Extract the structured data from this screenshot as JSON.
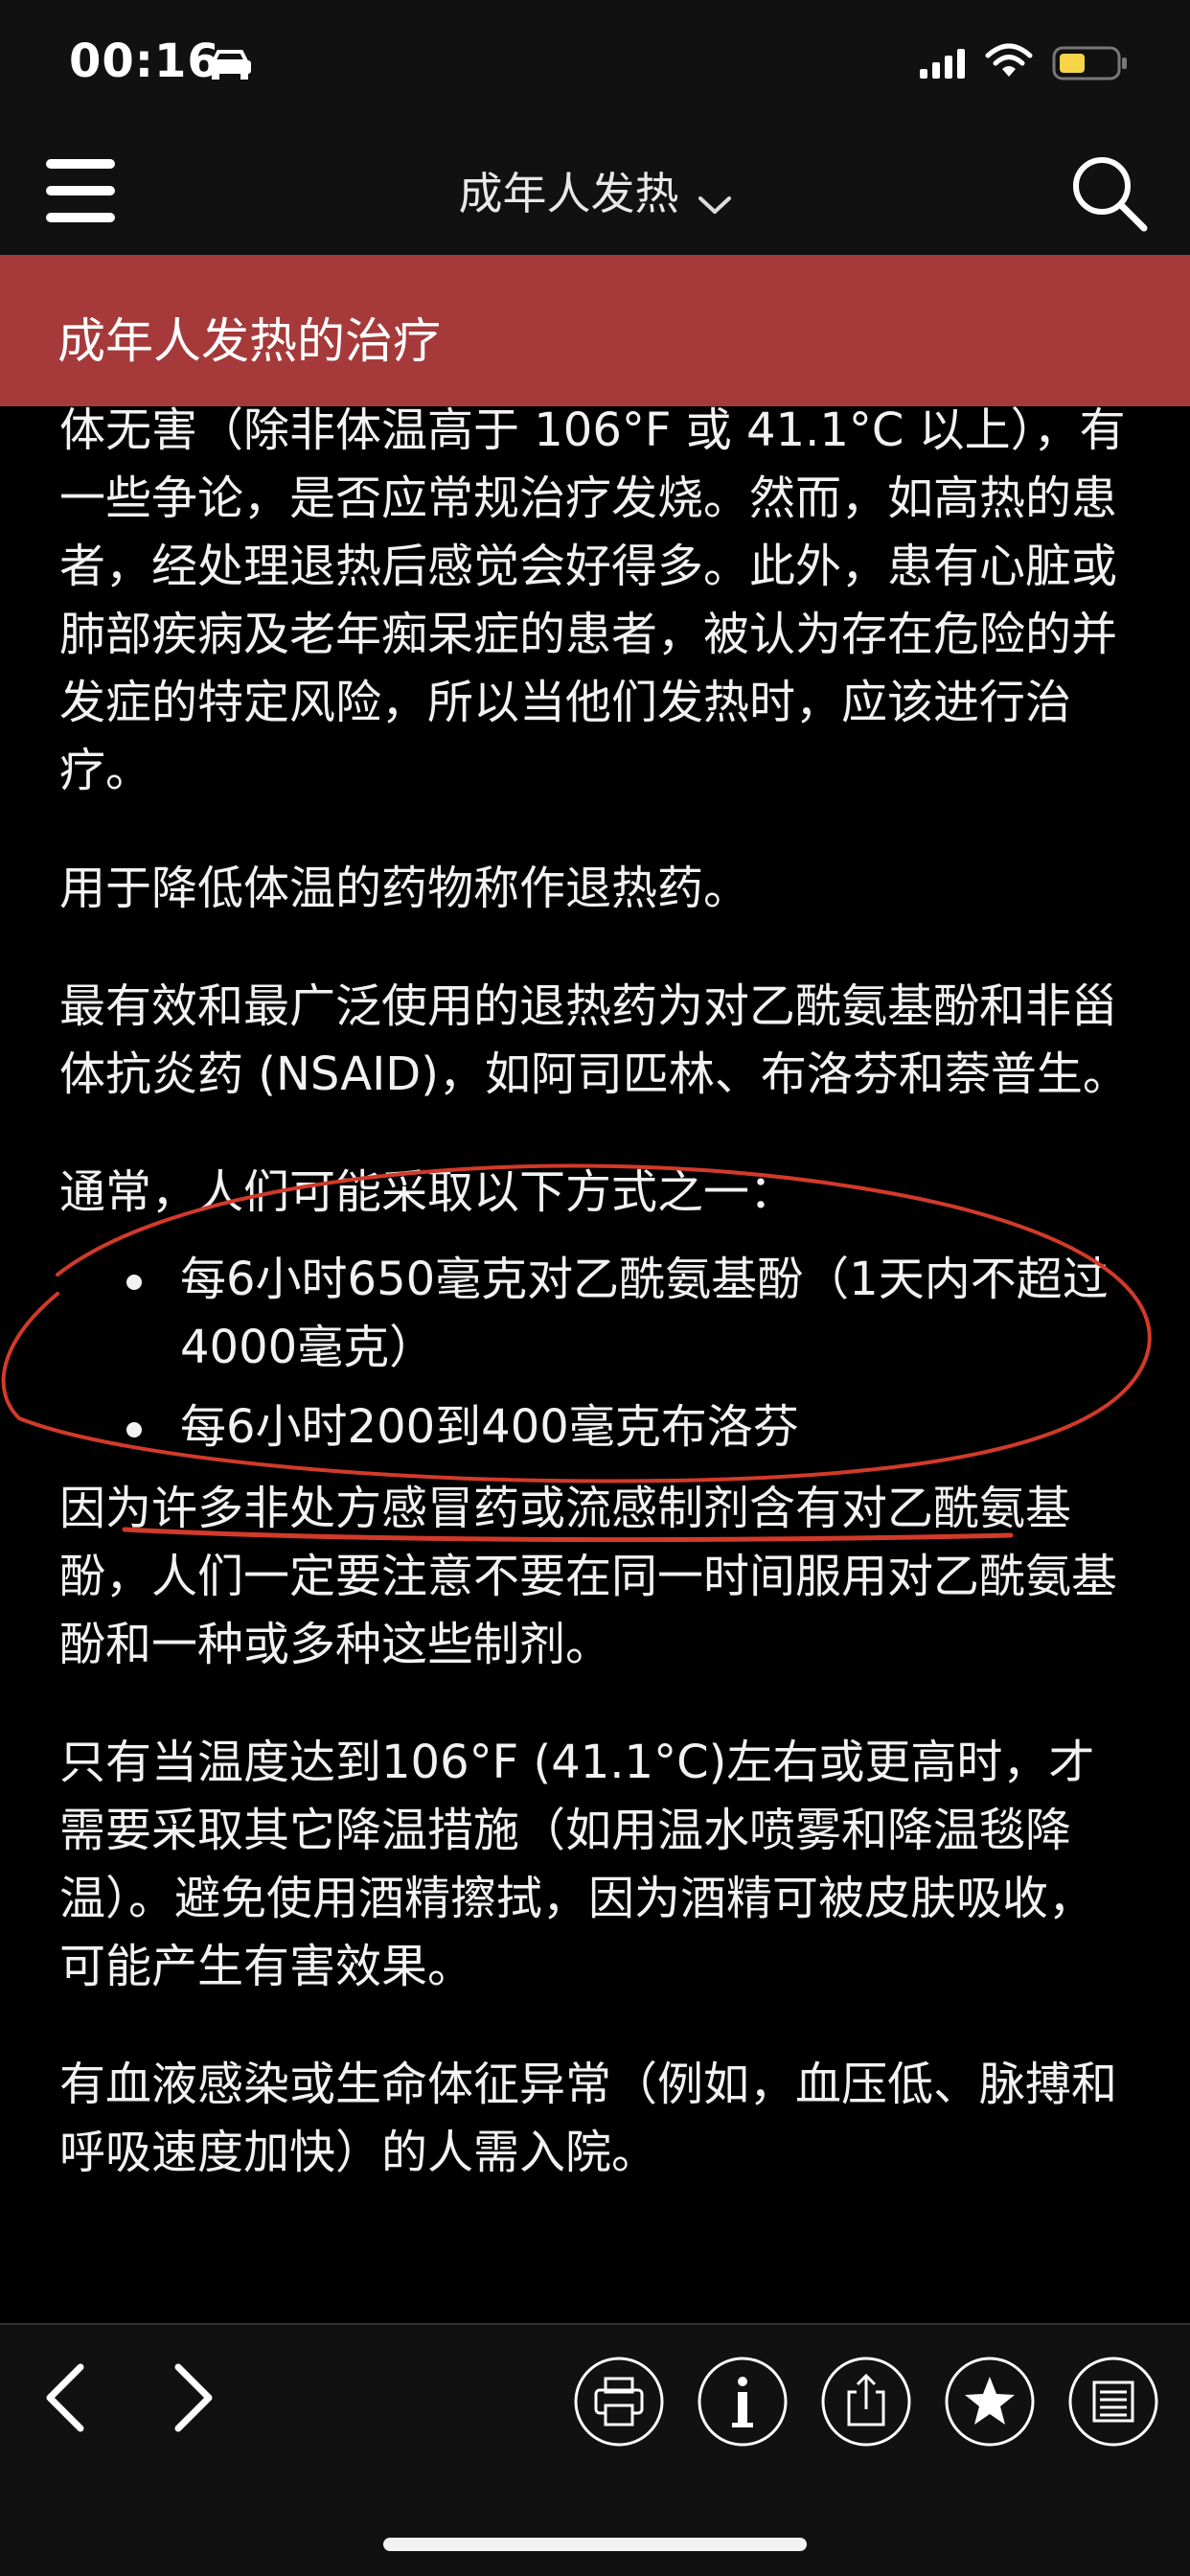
{
  "status_bar": {
    "time": "00:16",
    "icons": [
      "car-icon",
      "signal-icon",
      "wifi-icon",
      "battery-icon"
    ],
    "battery_color": "#f5d547"
  },
  "nav": {
    "title": "成年人发热",
    "icons": [
      "menu-icon",
      "chevron-down-icon",
      "search-icon"
    ]
  },
  "section": {
    "title": "成年人发热的治疗",
    "color": "#a63a3a"
  },
  "content": {
    "paragraphs": [
      "体无害（除非体温高于 106°F 或 41.1°C 以上），有一些争论，是否应常规治疗发烧。然而，如高热的患者，经处理退热后感觉会好得多。此外，患有心脏或肺部疾病及老年痴呆症的患者，被认为存在危险的并发症的特定风险，所以当他们发热时，应该进行治疗。",
      "用于降低体温的药物称作退热药。",
      "最有效和最广泛使用的退热药为对乙酰氨基酚和非甾体抗炎药 (NSAID)，如阿司匹林、布洛芬和萘普生。",
      "通常，人们可能采取以下方式之一："
    ],
    "bullets": [
      "每6小时650毫克对乙酰氨基酚（1天内不超过4000毫克）",
      "每6小时200到400毫克布洛芬"
    ],
    "paragraphs_after": [
      "因为许多非处方感冒药或流感制剂含有对乙酰氨基酚，人们一定要注意不要在同一时间服用对乙酰氨基酚和一种或多种这些制剂。",
      "只有当温度达到106°F (41.1°C)左右或更高时，才需要采取其它降温措施（如用温水喷雾和降温毯降温）。避免使用酒精擦拭，因为酒精可被皮肤吸收，可能产生有害效果。",
      "有血液感染或生命体征异常（例如，血压低、脉搏和呼吸速度加快）的人需入院。"
    ],
    "annotation_color": "#d23a2a"
  },
  "toolbar": {
    "icons": [
      "chevron-left-icon",
      "chevron-right-icon",
      "print-icon",
      "info-icon",
      "share-icon",
      "star-icon",
      "list-icon"
    ]
  }
}
